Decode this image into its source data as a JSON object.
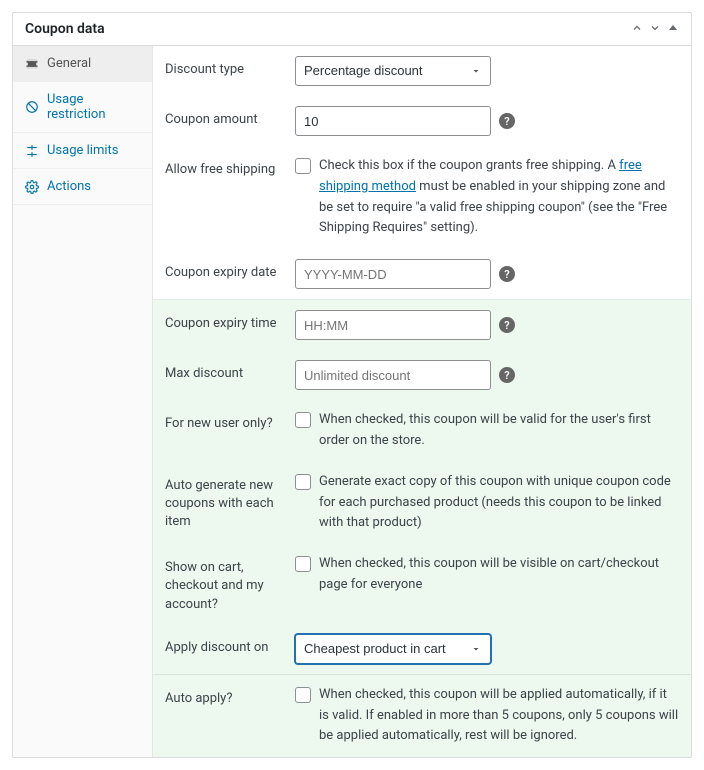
{
  "header": {
    "title": "Coupon data"
  },
  "sidebar": {
    "items": [
      {
        "label": "General"
      },
      {
        "label": "Usage restriction"
      },
      {
        "label": "Usage limits"
      },
      {
        "label": "Actions"
      }
    ]
  },
  "fields": {
    "discount_type": {
      "label": "Discount type",
      "value": "Percentage discount"
    },
    "coupon_amount": {
      "label": "Coupon amount",
      "value": "10"
    },
    "free_shipping": {
      "label": "Allow free shipping",
      "desc_pre": "Check this box if the coupon grants free shipping. A ",
      "link": "free shipping method",
      "desc_post": " must be enabled in your shipping zone and be set to require \"a valid free shipping coupon\" (see the \"Free Shipping Requires\" setting)."
    },
    "expiry_date": {
      "label": "Coupon expiry date",
      "placeholder": "YYYY-MM-DD"
    },
    "expiry_time": {
      "label": "Coupon expiry time",
      "placeholder": "HH:MM"
    },
    "max_discount": {
      "label": "Max discount",
      "placeholder": "Unlimited discount"
    },
    "new_user": {
      "label": "For new user only?",
      "desc": "When checked, this coupon will be valid for the user's first order on the store."
    },
    "auto_generate": {
      "label": "Auto generate new coupons with each item",
      "desc": "Generate exact copy of this coupon with unique coupon code for each purchased product (needs this coupon to be linked with that product)"
    },
    "show_on_cart": {
      "label": "Show on cart, checkout and my account?",
      "desc": "When checked, this coupon will be visible on cart/checkout page for everyone"
    },
    "apply_discount_on": {
      "label": "Apply discount on",
      "value": "Cheapest product in cart"
    },
    "auto_apply": {
      "label": "Auto apply?",
      "desc": "When checked, this coupon will be applied automatically, if it is valid. If enabled in more than 5 coupons, only 5 coupons will be applied automatically, rest will be ignored."
    }
  }
}
